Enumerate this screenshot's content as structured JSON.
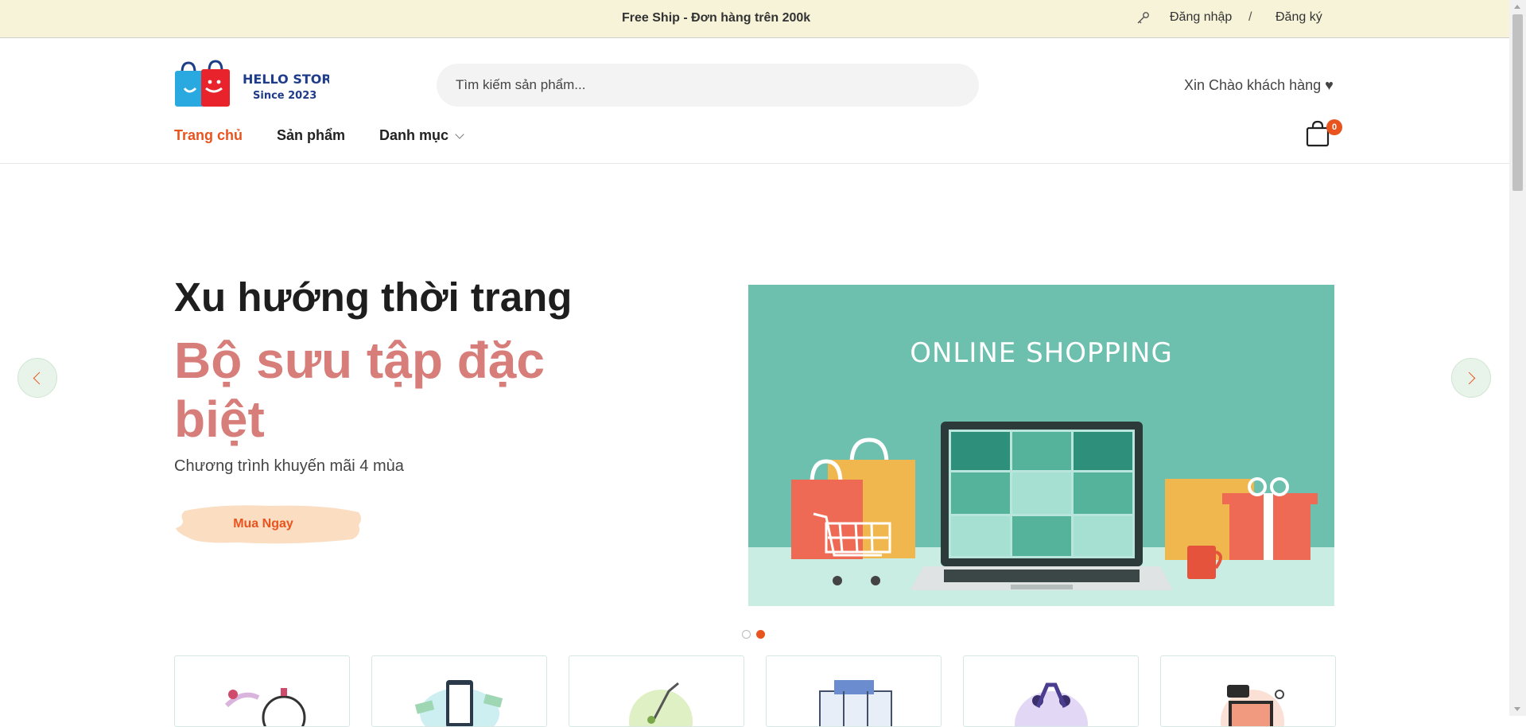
{
  "topbar": {
    "promo": "Free Ship - Đơn hàng trên 200k",
    "login": "Đăng nhập",
    "separator": "/",
    "register": "Đăng ký",
    "icon": "key-icon"
  },
  "header": {
    "logo": {
      "text": "HELLO STORE",
      "tagline": "Since 2023"
    },
    "search_placeholder": "Tìm kiếm sản phẩm...",
    "greeting": "Xin Chào khách hàng ♥",
    "nav": [
      {
        "label": "Trang chủ",
        "active": true
      },
      {
        "label": "Sản phẩm",
        "active": false
      },
      {
        "label": "Danh mục",
        "active": false,
        "dropdown": true
      }
    ],
    "cart_count": "0"
  },
  "hero": {
    "title": "Xu hướng thời trang",
    "subtitle": "Bộ sưu tập đặc biệt",
    "description": "Chương trình khuyến mãi 4 mùa",
    "cta": "Mua Ngay",
    "banner_title": "ONLINE SHOPPING",
    "slides": 2,
    "active_slide": 2
  },
  "categories": [
    {
      "icon": "delivery-icon"
    },
    {
      "icon": "mobile-payment-icon"
    },
    {
      "icon": "quality-icon"
    },
    {
      "icon": "shop-icon"
    },
    {
      "icon": "support-icon"
    },
    {
      "icon": "online-order-icon"
    }
  ],
  "colors": {
    "accent": "#e9541e",
    "topbar_bg": "#f6f3d8",
    "hero_subtitle": "#d77d7a",
    "banner_bg": "#6dbfae"
  }
}
